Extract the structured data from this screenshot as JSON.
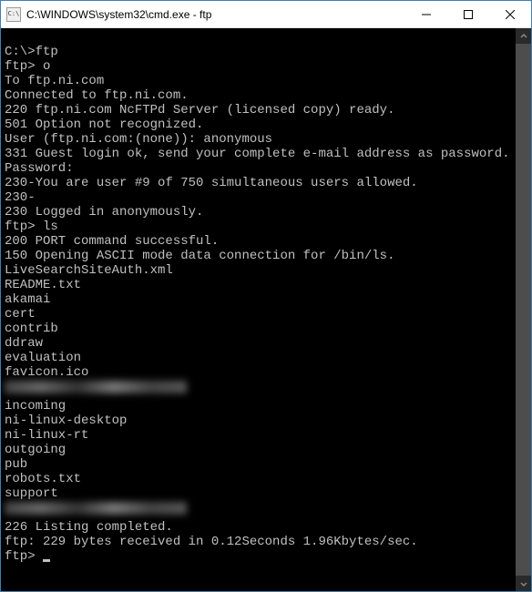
{
  "window": {
    "title": "C:\\WINDOWS\\system32\\cmd.exe - ftp",
    "icon_label": "C:\\"
  },
  "terminal": {
    "lines": [
      "",
      "C:\\>ftp",
      "ftp> o",
      "To ftp.ni.com",
      "Connected to ftp.ni.com.",
      "220 ftp.ni.com NcFTPd Server (licensed copy) ready.",
      "501 Option not recognized.",
      "User (ftp.ni.com:(none)): anonymous",
      "331 Guest login ok, send your complete e-mail address as password.",
      "Password:",
      "230-You are user #9 of 750 simultaneous users allowed.",
      "230-",
      "230 Logged in anonymously.",
      "ftp> ls",
      "200 PORT command successful.",
      "150 Opening ASCII mode data connection for /bin/ls.",
      "LiveSearchSiteAuth.xml",
      "README.txt",
      "akamai",
      "cert",
      "contrib",
      "ddraw",
      "evaluation",
      "favicon.ico",
      "__BLURRED__",
      "incoming",
      "ni-linux-desktop",
      "ni-linux-rt",
      "outgoing",
      "pub",
      "robots.txt",
      "support",
      "__BLURRED__",
      "226 Listing completed.",
      "ftp: 229 bytes received in 0.12Seconds 1.96Kbytes/sec."
    ],
    "prompt": "ftp> "
  }
}
